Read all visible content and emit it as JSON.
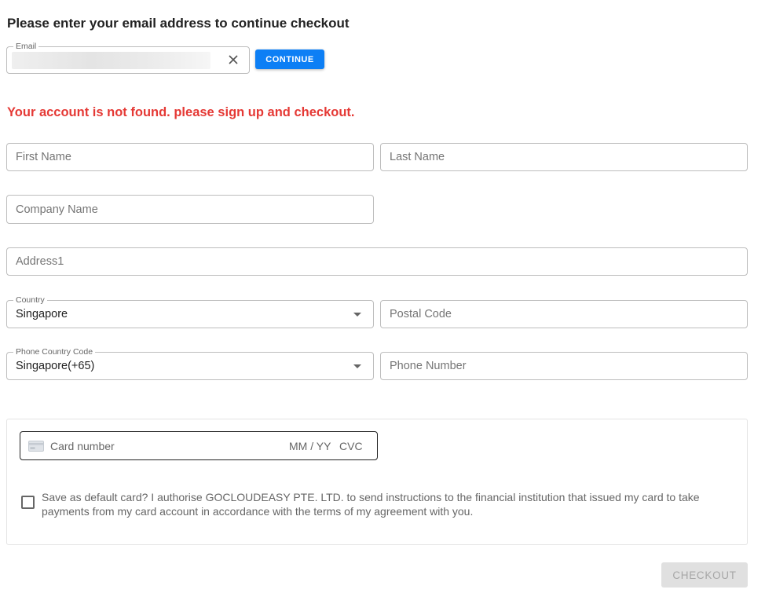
{
  "header": {
    "title": "Please enter your email address to continue checkout"
  },
  "email": {
    "label": "Email",
    "continue_label": "CONTINUE"
  },
  "error_message": "Your account is not found. please sign up and checkout.",
  "form": {
    "first_name_placeholder": "First Name",
    "last_name_placeholder": "Last Name",
    "company_name_placeholder": "Company Name",
    "address1_placeholder": "Address1",
    "country_label": "Country",
    "country_value": "Singapore",
    "postal_code_placeholder": "Postal Code",
    "phone_country_code_label": "Phone Country Code",
    "phone_country_code_value": "Singapore(+65)",
    "phone_number_placeholder": "Phone Number"
  },
  "payment": {
    "card_number_placeholder": "Card number",
    "expiry_placeholder": "MM / YY",
    "cvc_placeholder": "CVC",
    "save_default_text": "Save as default card? I authorise GOCLOUDEASY PTE. LTD. to send instructions to the financial institution that issued my card to take payments from my card account in accordance with the terms of my agreement with you."
  },
  "checkout_label": "CHECKOUT",
  "icons": {
    "clear": "close-icon",
    "dropdown": "chevron-down-icon",
    "card": "credit-card-icon"
  },
  "colors": {
    "primary": "#0d7ff5",
    "error": "#e53935",
    "disabled_bg": "#e0e0e0",
    "disabled_text": "#a6a6a6"
  }
}
